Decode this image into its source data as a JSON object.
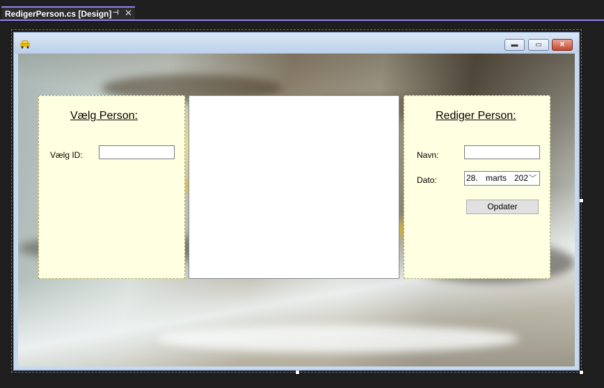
{
  "tab": {
    "title": "RedigerPerson.cs [Design]",
    "pin_icon": "pin-icon",
    "close_icon": "close-icon"
  },
  "form": {
    "window_buttons": {
      "minimize": "minimize-icon",
      "maximize": "maximize-icon",
      "close": "close-icon"
    },
    "left_panel": {
      "heading": "Vælg Person:",
      "id_label": "Vælg ID:",
      "id_value": ""
    },
    "right_panel": {
      "heading": "Rediger Person:",
      "name_label": "Navn:",
      "name_value": "",
      "date_label": "Dato:",
      "date_day": "28.",
      "date_month": "marts",
      "date_year": "202",
      "update_button": "Opdater"
    }
  },
  "colors": {
    "accent": "#9184ee",
    "panel_bg": "#ffffe1"
  }
}
